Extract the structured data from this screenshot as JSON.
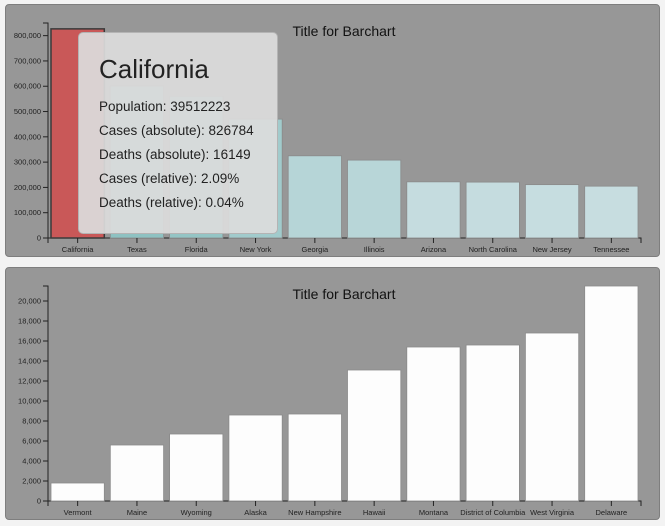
{
  "charts": [
    {
      "id": "top",
      "chart_data": {
        "type": "bar",
        "title": "Title for Barchart",
        "categories": [
          "California",
          "Texas",
          "Florida",
          "New York",
          "Georgia",
          "Illinois",
          "Arizona",
          "North Carolina",
          "New Jersey",
          "Tennessee"
        ],
        "values": [
          826784,
          600000,
          560000,
          470000,
          325000,
          308000,
          222000,
          221000,
          211000,
          205000
        ],
        "ylim": [
          0,
          850000
        ],
        "yticks": [
          0,
          100000,
          200000,
          300000,
          400000,
          500000,
          600000,
          700000,
          800000
        ],
        "ytick_labels": [
          "0",
          "100,000",
          "200,000",
          "300,000",
          "400,000",
          "500,000",
          "600,000",
          "700,000",
          "800,000"
        ],
        "xlabel": "",
        "ylabel": "",
        "highlight_index": 0,
        "highlight_color": "#c95858",
        "color_range": [
          "#8ec2c2",
          "#c7dde0"
        ]
      }
    },
    {
      "id": "bottom",
      "chart_data": {
        "type": "bar",
        "title": "Title for Barchart",
        "categories": [
          "Vermont",
          "Maine",
          "Wyoming",
          "Alaska",
          "New Hampshire",
          "Hawaii",
          "Montana",
          "District of Columbia",
          "West Virginia",
          "Delaware"
        ],
        "values": [
          1800,
          5600,
          6700,
          8600,
          8700,
          13100,
          15400,
          15600,
          16800,
          21500
        ],
        "ylim": [
          0,
          21500
        ],
        "yticks": [
          0,
          2000,
          4000,
          6000,
          8000,
          10000,
          12000,
          14000,
          16000,
          18000,
          20000
        ],
        "ytick_labels": [
          "0",
          "2,000",
          "4,000",
          "6,000",
          "8,000",
          "10,000",
          "12,000",
          "14,000",
          "16,000",
          "18,000",
          "20,000"
        ],
        "xlabel": "",
        "ylabel": "",
        "bar_color": "#fdfdfd"
      }
    }
  ],
  "tooltip": {
    "title": "California",
    "lines": [
      "Population: 39512223",
      "Cases (absolute): 826784",
      "Deaths (absolute): 16149",
      "Cases (relative): 2.09%",
      "Deaths (relative): 0.04%"
    ]
  }
}
